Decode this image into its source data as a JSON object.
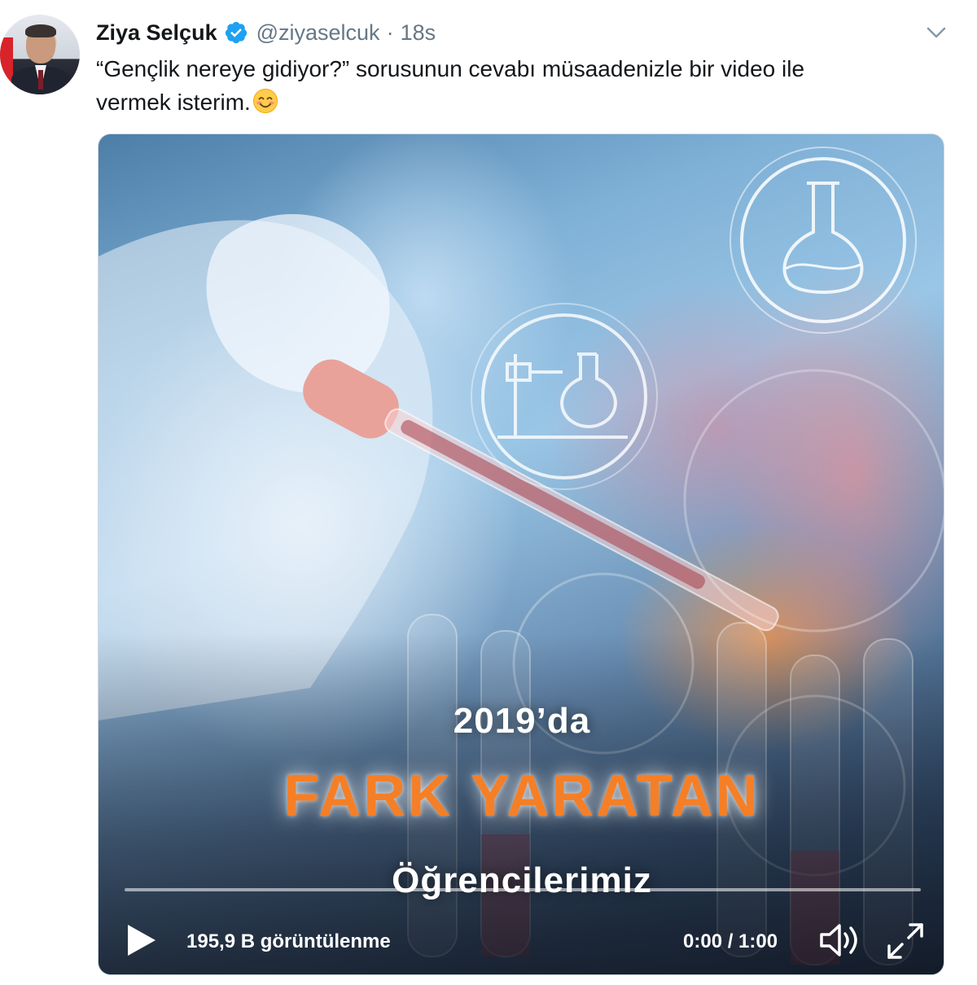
{
  "tweet": {
    "author": {
      "display_name": "Ziya Selçuk",
      "handle": "@ziyaselcuk",
      "separator": "·",
      "timestamp": "18s",
      "verified": true
    },
    "text_line1": "“Gençlik nereye gidiyor?” sorusunun cevabı müsaadenizle bir video ile",
    "text_line2": "vermek isterim.",
    "emoji": "smiling-face-with-smiling-eyes"
  },
  "video": {
    "overlay_year": "2019’da",
    "overlay_title": "FARK YARATAN",
    "overlay_subtitle": "Öğrencilerimiz",
    "views": "195,9 B görüntülenme",
    "time": "0:00 / 1:00",
    "progress": 0,
    "accent_color": "#f57f26"
  },
  "colors": {
    "verified": "#1da1f2",
    "secondary_text": "#657786"
  }
}
